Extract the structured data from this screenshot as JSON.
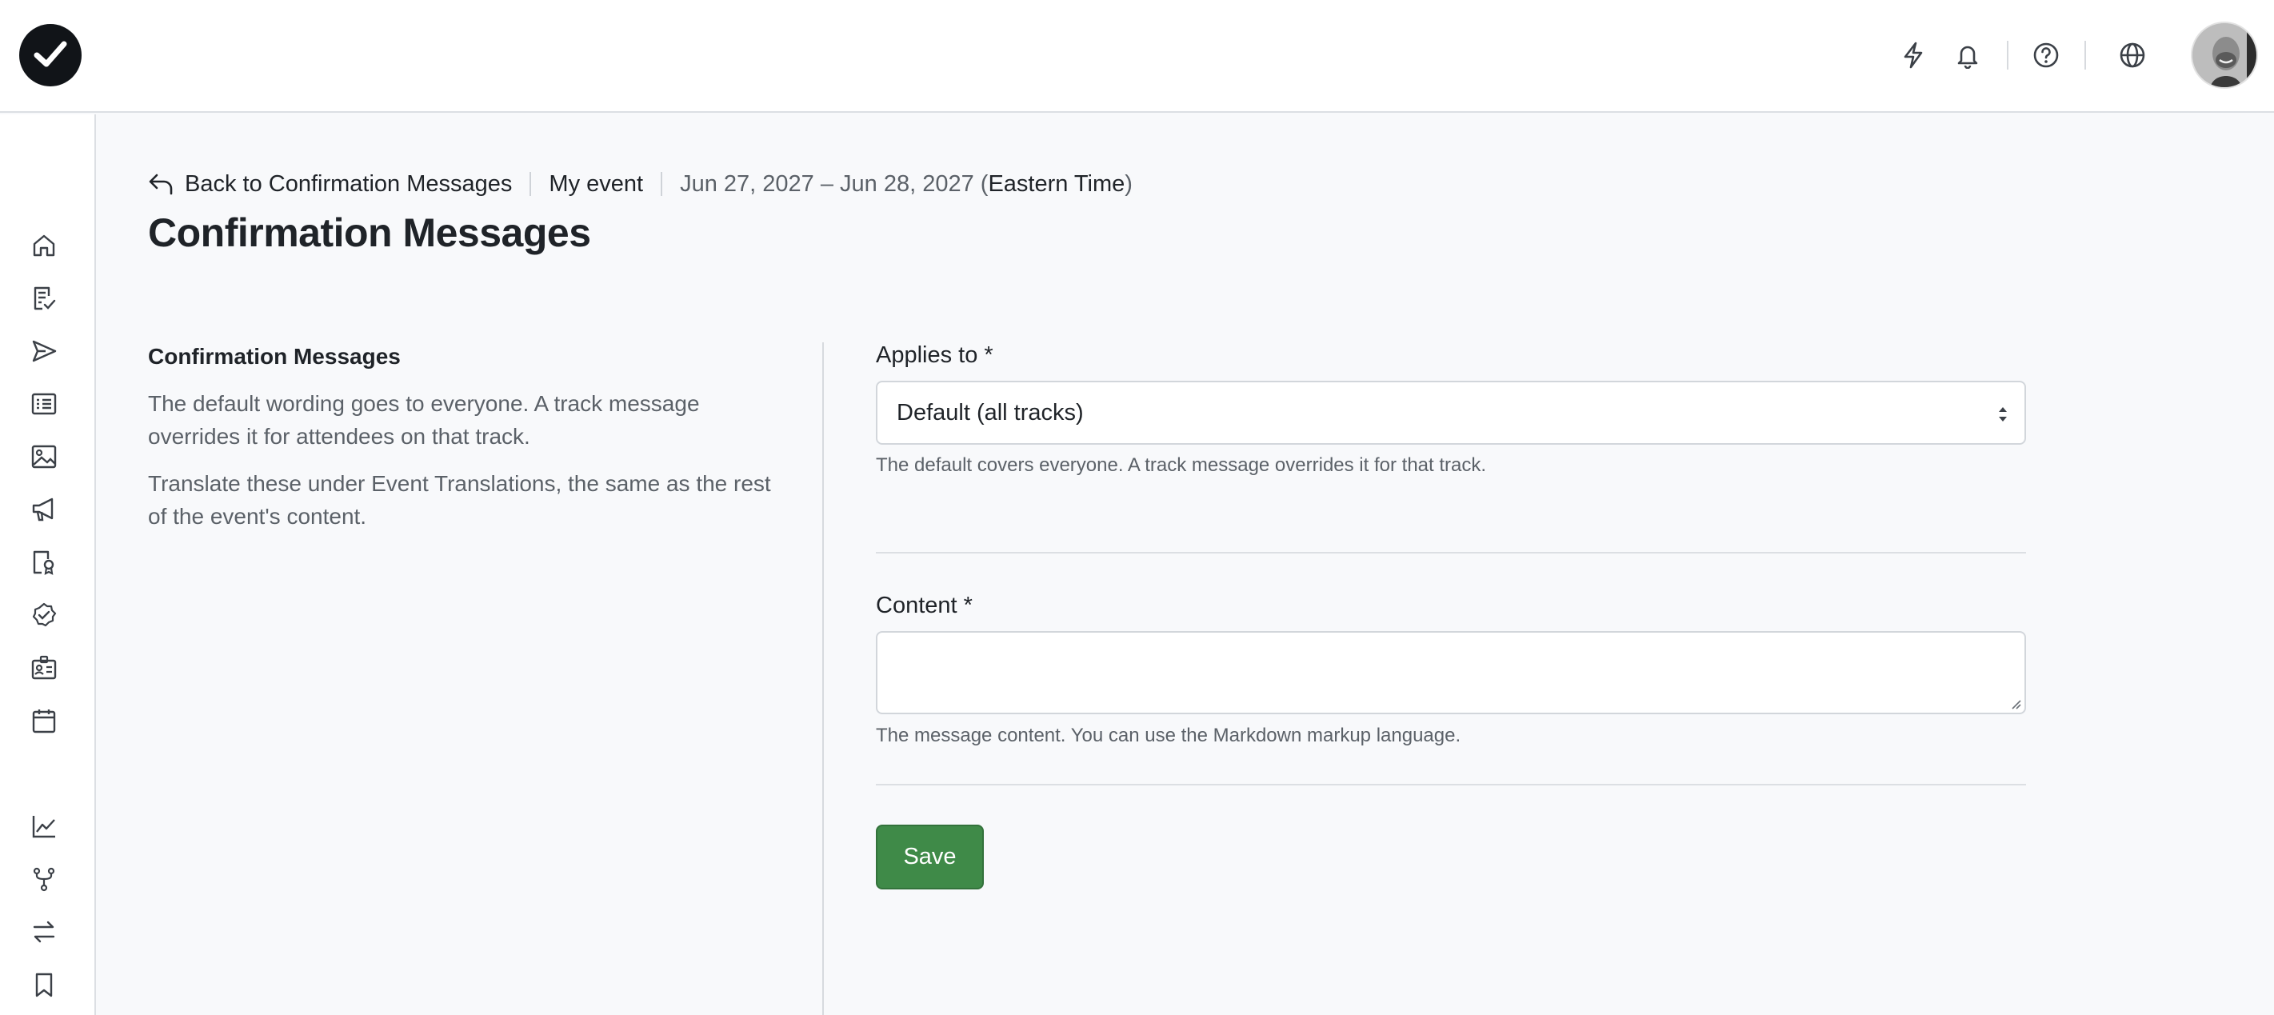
{
  "topbar": {
    "logo_icon": "checkmark-logo-icon",
    "icons": [
      "lightning-icon",
      "bell-icon",
      "help-circle-icon",
      "globe-icon"
    ],
    "avatar": "user-avatar"
  },
  "sidebar": {
    "items": [
      "home-icon",
      "checklist-icon",
      "send-icon",
      "list-icon",
      "image-icon",
      "megaphone-icon",
      "badge-icon",
      "check-badge-icon",
      "id-card-icon",
      "calendar-icon",
      "chart-icon",
      "branch-icon",
      "swap-icon",
      "bookmark-icon"
    ]
  },
  "breadcrumb": {
    "back_label": "Back to Confirmation Messages",
    "event_name": "My event",
    "date_range": "Jun 27, 2027 – Jun 28, 2027 (",
    "timezone": "Eastern Time",
    "date_close": ")"
  },
  "page": {
    "title": "Confirmation Messages"
  },
  "section": {
    "title": "Confirmation Messages",
    "paragraphs": [
      "The default wording goes to everyone. A track message overrides it for attendees on that track.",
      "Translate these under Event Translations, the same as the rest of the event's content."
    ]
  },
  "form": {
    "applies_to": {
      "label": "Applies to",
      "required": "*",
      "value": "Default (all tracks)",
      "help": "The default covers everyone. A track message overrides it for that track."
    },
    "content": {
      "label": "Content",
      "required": "*",
      "value": "",
      "help": "The message content. You can use the Markdown markup language."
    },
    "save_label": "Save"
  },
  "colors": {
    "save_button": "#3f8a48",
    "logo": "#111418"
  }
}
